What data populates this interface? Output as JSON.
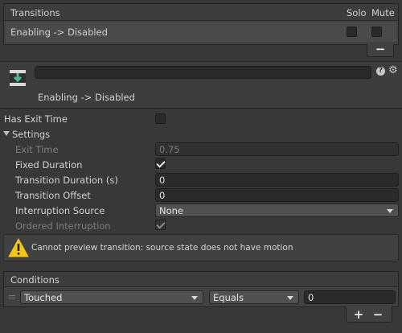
{
  "transitions": {
    "header": "Transitions",
    "solo_label": "Solo",
    "mute_label": "Mute",
    "row_label": "Enabling -> Disabled",
    "remove_button": "−"
  },
  "transition_header": {
    "name_field_value": "",
    "subtitle": "Enabling -> Disabled",
    "help_icon": "help-icon",
    "settings_icon": "gear-icon"
  },
  "settings": {
    "has_exit_time_label": "Has Exit Time",
    "settings_foldout": "Settings",
    "exit_time_label": "Exit Time",
    "exit_time_value": "0.75",
    "fixed_duration_label": "Fixed Duration",
    "transition_duration_label": "Transition Duration (s)",
    "transition_duration_value": "0",
    "transition_offset_label": "Transition Offset",
    "transition_offset_value": "0",
    "interruption_source_label": "Interruption Source",
    "interruption_source_value": "None",
    "ordered_interruption_label": "Ordered Interruption"
  },
  "warning": {
    "text": "Cannot preview transition: source state does not have motion"
  },
  "conditions": {
    "header": "Conditions",
    "parameter": "Touched",
    "operator": "Equals",
    "value": "0",
    "add_button": "+",
    "remove_button": "−"
  },
  "colors": {
    "background": "#383838",
    "warning_yellow": "#f5c518",
    "transition_icon_green": "#4fb89a"
  }
}
